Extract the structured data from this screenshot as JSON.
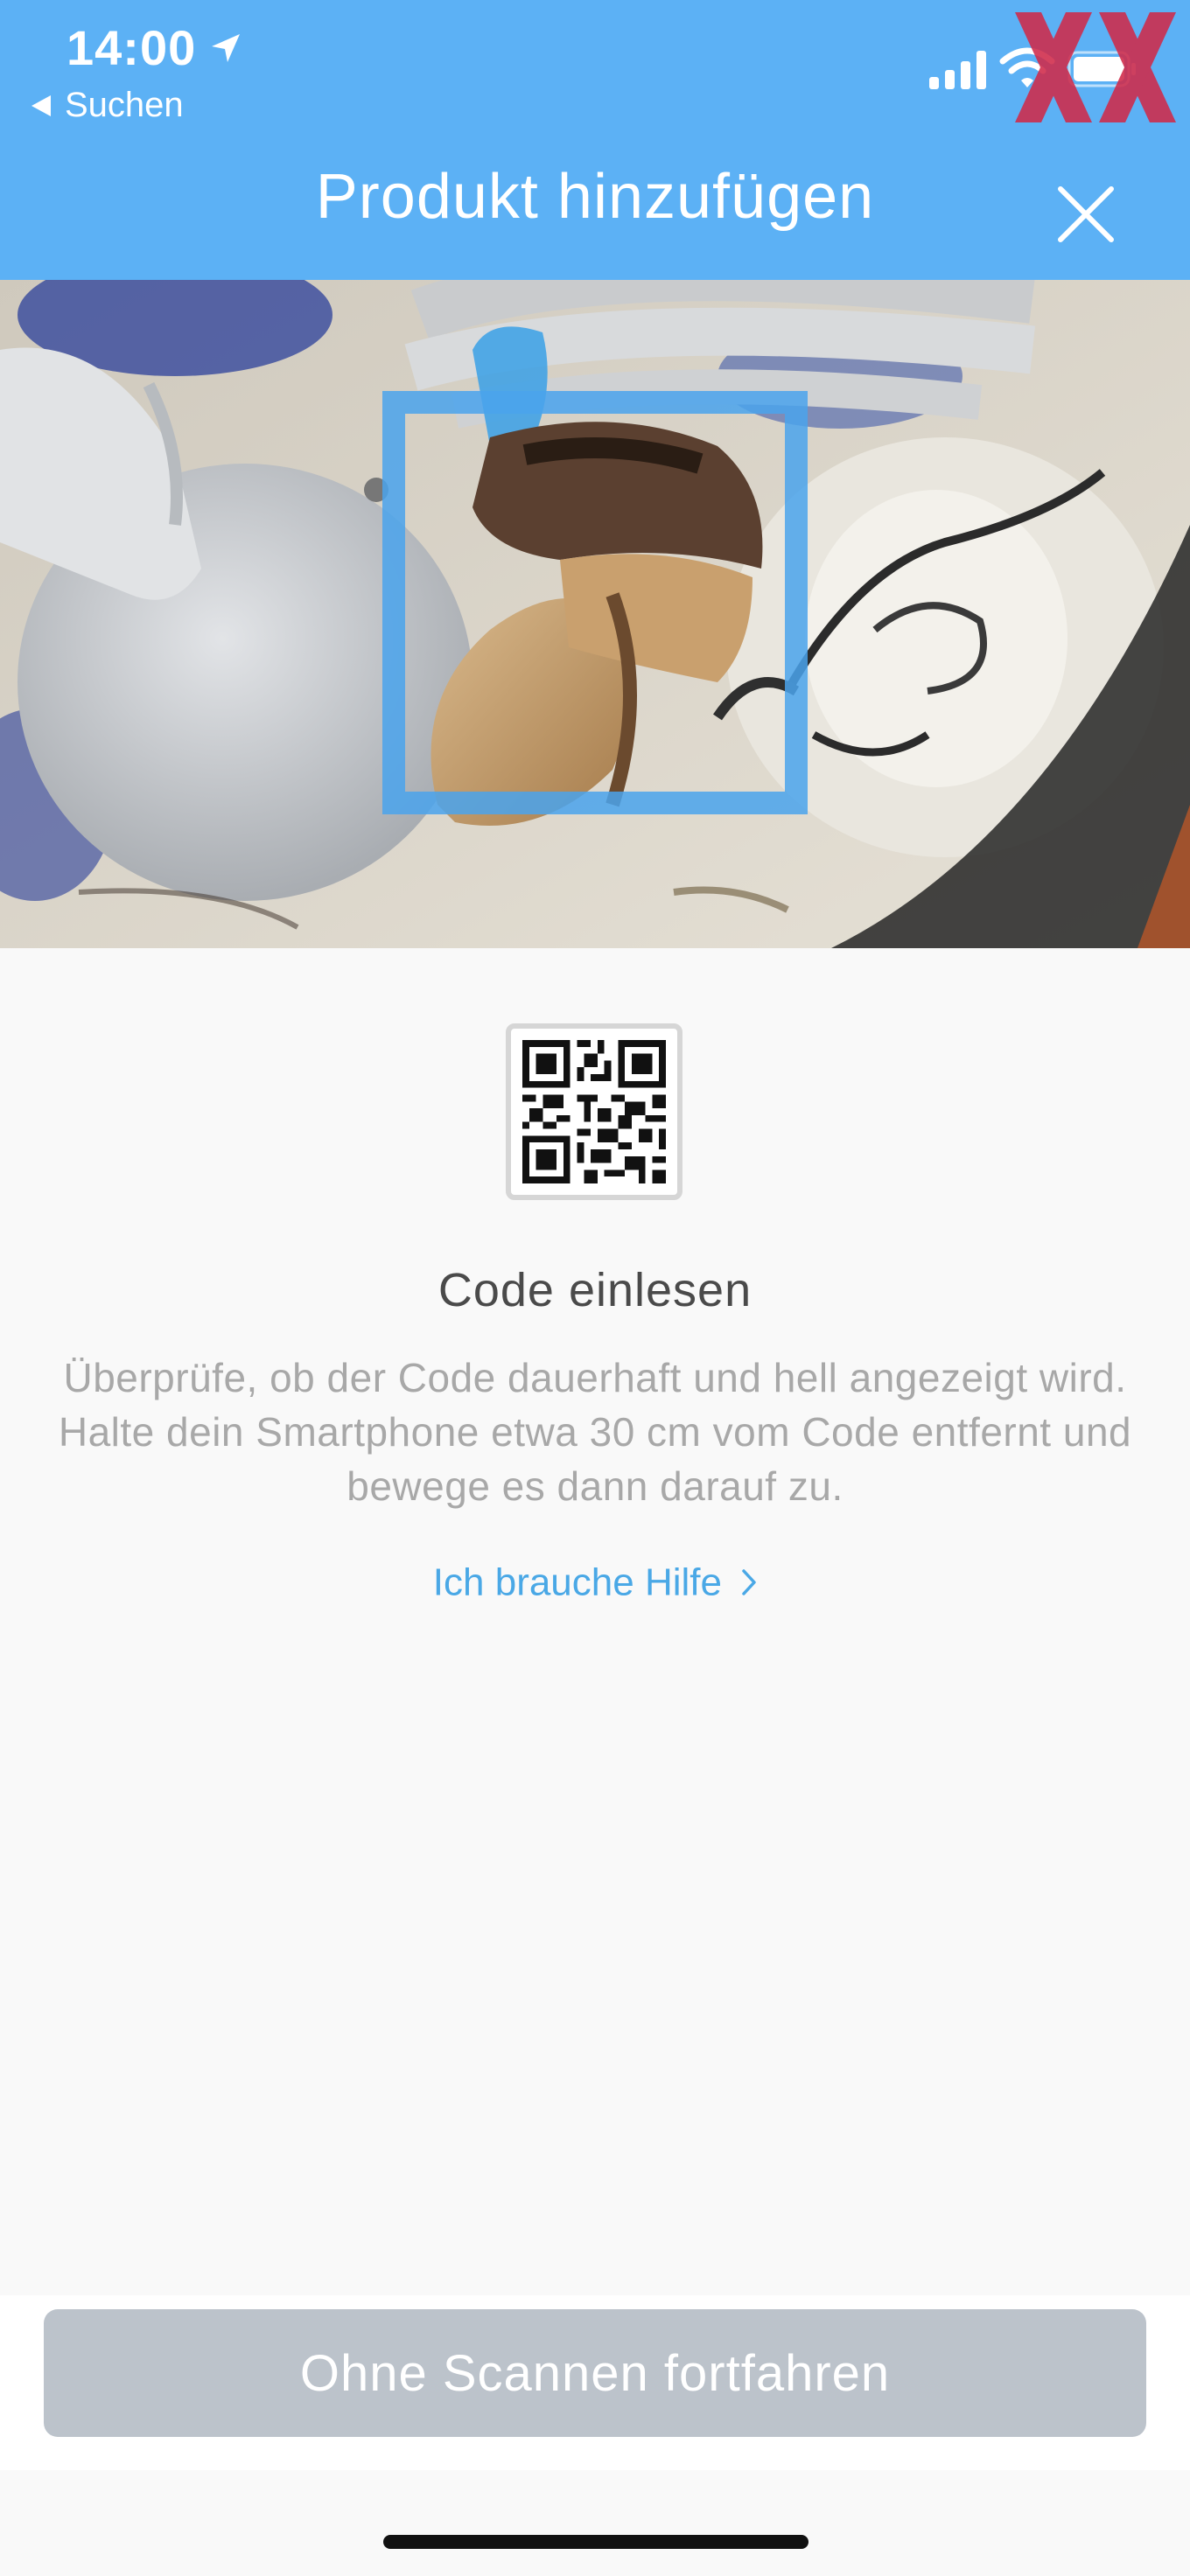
{
  "status_bar": {
    "time": "14:00",
    "back_label": "Suchen"
  },
  "header": {
    "title": "Produkt hinzufügen"
  },
  "instructions": {
    "title": "Code einlesen",
    "body": "Überprüfe, ob der Code dauerhaft und hell angezeigt wird. Halte dein Smartphone etwa 30 cm vom Code entfernt und bewege es dann darauf zu.",
    "help_link": "Ich brauche Hilfe"
  },
  "footer": {
    "continue_label": "Ohne Scannen fortfahren"
  },
  "icons": {
    "location": "location-arrow-icon",
    "back": "back-arrow-icon",
    "signal": "cellular-signal-icon",
    "wifi": "wifi-icon",
    "battery": "battery-icon",
    "close": "close-icon",
    "qr": "qr-code-icon",
    "chevron": "chevron-right-icon"
  },
  "colors": {
    "header": "#5cb1f5",
    "link": "#4aa8e6",
    "button": "#bcc3cb",
    "scan_frame": "#4aa3ec"
  }
}
